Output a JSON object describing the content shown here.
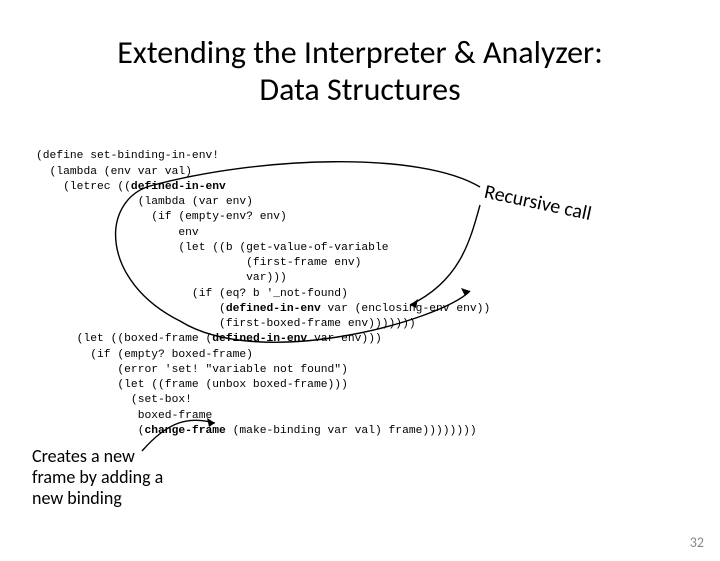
{
  "title_line1": "Extending the Interpreter & Analyzer:",
  "title_line2": "Data Structures",
  "code_lines": [
    "(define set-binding-in-env!",
    "  (lambda (env var val)",
    "    (letrec ((defined-in-env",
    "               (lambda (var env)",
    "                 (if (empty-env? env)",
    "                     env",
    "                     (let ((b (get-value-of-variable",
    "                               (first-frame env)",
    "                               var)))",
    "                       (if (eq? b '_not-found)",
    "                           (defined-in-env var (enclosing-env env))",
    "                           (first-boxed-frame env)))))))",
    "      (let ((boxed-frame (defined-in-env var env)))",
    "        (if (empty? boxed-frame)",
    "            (error 'set! \"variable not found\")",
    "            (let ((frame (unbox boxed-frame)))",
    "              (set-box!",
    "               boxed-frame",
    "               (change-frame (make-binding var val) frame))))))))"
  ],
  "bold_tokens": [
    "defined-in-env",
    "change-frame"
  ],
  "annotation_recursive": "Recursive call",
  "annotation_creates": "Creates a new frame by adding a new binding",
  "page_number": "32"
}
